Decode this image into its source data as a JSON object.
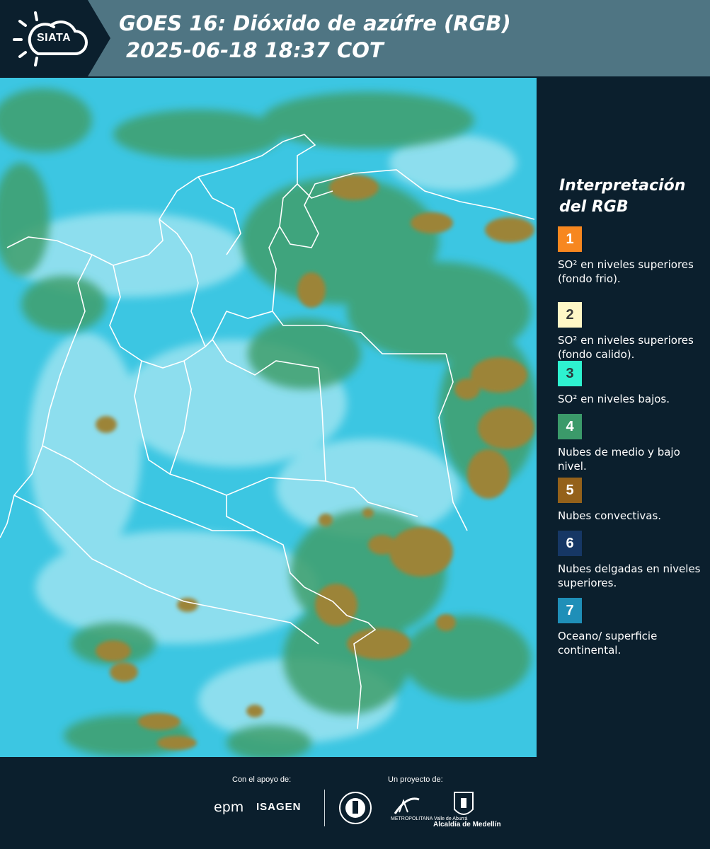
{
  "header": {
    "logo_text": "SIATA",
    "title_line1": "GOES 16: Dióxido de azúfre (RGB)",
    "title_line2": "2025-06-18 18:37 COT",
    "band_color": "#4f7583"
  },
  "map": {
    "background_color": "#3cc6e2",
    "cloud_low_color": "#3f9f6c",
    "cloud_convective_color": "#9c8437",
    "thin_cloud_color": "#a8e7f2",
    "border_color": "#ffffff"
  },
  "legend": {
    "title": "Interpretación del RGB",
    "items": [
      {
        "number": "1",
        "color": "#f7871f",
        "number_color": "#ffffff",
        "label": "SO² en niveles superiores (fondo frio)."
      },
      {
        "number": "2",
        "color": "#fff7c6",
        "number_color": "#3a3a3a",
        "label": "SO² en niveles superiores (fondo calido)."
      },
      {
        "number": "3",
        "color": "#2ef2d0",
        "number_color": "#2a3a3a",
        "label": "SO² en niveles bajos."
      },
      {
        "number": "4",
        "color": "#3b9a6a",
        "number_color": "#ffffff",
        "label": "Nubes de medio y bajo nivel."
      },
      {
        "number": "5",
        "color": "#94611a",
        "number_color": "#ffffff",
        "label": "Nubes convectivas."
      },
      {
        "number": "6",
        "color": "#163765",
        "number_color": "#ffffff",
        "label": "Nubes delgadas en niveles superiores."
      },
      {
        "number": "7",
        "color": "#1f8fb8",
        "number_color": "#ffffff",
        "label": "Oceano/ superficie continental."
      }
    ]
  },
  "footer": {
    "support_label": "Con el apoyo de:",
    "project_label": "Un proyecto de:",
    "sponsor_1": "epm",
    "sponsor_2": "ISAGEN",
    "partner_area": "METROPOLITANA Valle de Aburrá",
    "partner_alcaldia": "Alcaldía de Medellín"
  }
}
